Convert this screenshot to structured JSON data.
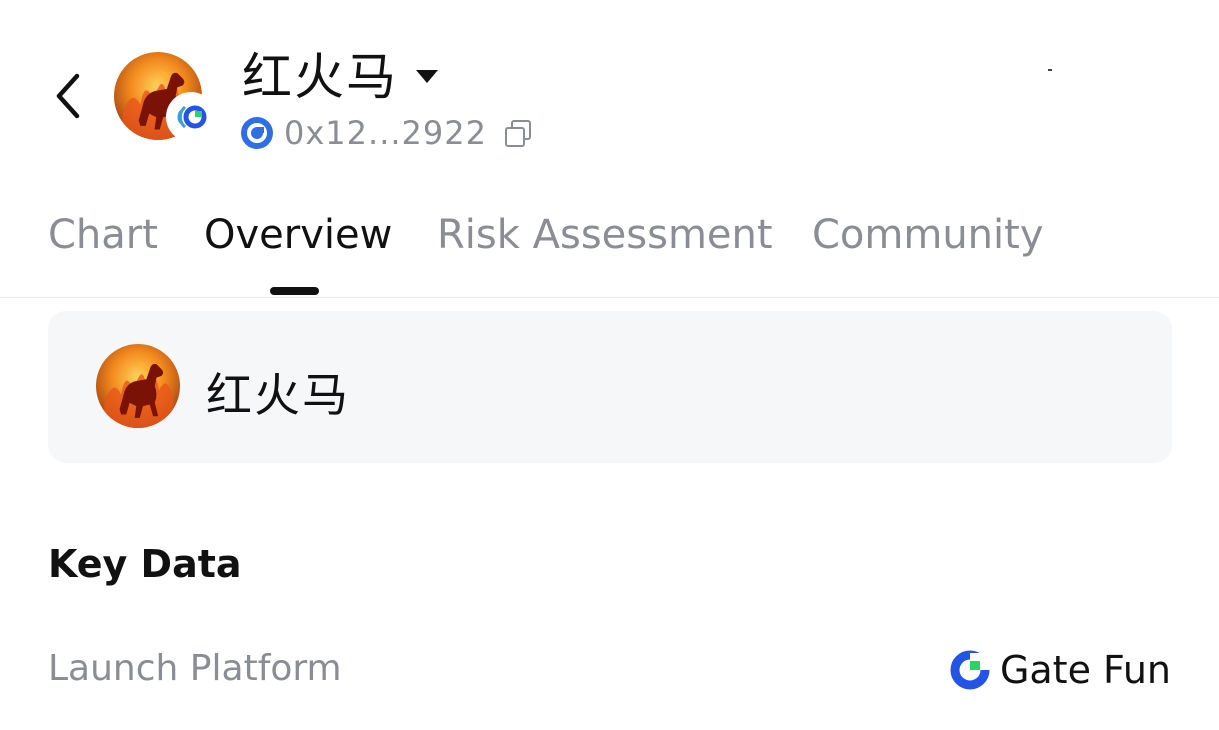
{
  "header": {
    "token_name": "红火马",
    "address": "0x12...2922",
    "icons": {
      "back": "chevron-left-icon",
      "copy": "copy-icon",
      "chain": "gate-chain-icon",
      "dropdown": "caret-down-icon"
    }
  },
  "tabs": [
    {
      "label": "Chart"
    },
    {
      "label": "Overview",
      "active": true
    },
    {
      "label": "Risk Assessment"
    },
    {
      "label": "Community"
    }
  ],
  "token_card": {
    "name": "红火马"
  },
  "key_data": {
    "title": "Key Data",
    "rows": [
      {
        "label": "Launch Platform",
        "value": "Gate Fun",
        "icon": "gate-fun-logo-icon"
      }
    ]
  },
  "colors": {
    "accent_blue": "#2354e6",
    "accent_green": "#2bd36b",
    "muted_text": "#8a8d93",
    "card_bg": "#f6f7f8"
  }
}
